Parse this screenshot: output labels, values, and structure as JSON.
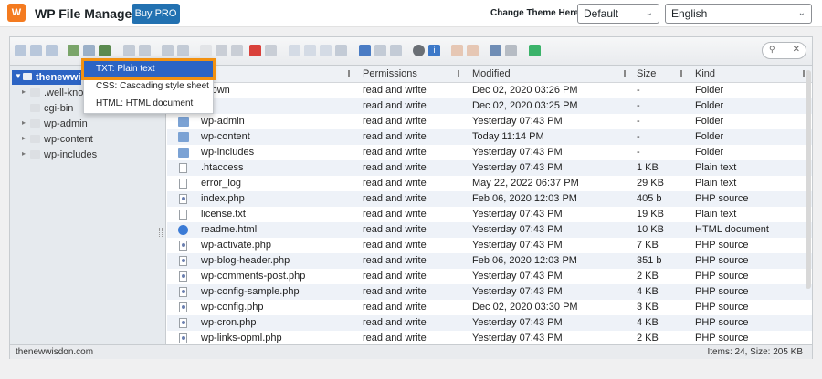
{
  "header": {
    "app_title": "WP File Manager",
    "buy_pro_label": "Buy PRO",
    "theme_label": "Change Theme Here:",
    "theme_value": "Default",
    "language_value": "English"
  },
  "tree": {
    "root_label": "thenewwisdon",
    "items": [
      {
        "label": ".well-known",
        "expandable": true
      },
      {
        "label": "cgi-bin",
        "expandable": false
      },
      {
        "label": "wp-admin",
        "expandable": true
      },
      {
        "label": "wp-content",
        "expandable": true
      },
      {
        "label": "wp-includes",
        "expandable": true
      }
    ]
  },
  "dropdown": {
    "items": [
      {
        "label": "TXT: Plain text",
        "selected": true
      },
      {
        "label": "CSS: Cascading style sheet",
        "selected": false
      },
      {
        "label": "HTML: HTML document",
        "selected": false
      }
    ]
  },
  "table": {
    "columns": [
      "Permissions",
      "Modified",
      "Size",
      "Kind"
    ],
    "rows": [
      {
        "name": "known",
        "perm": "read and write",
        "modified": "Dec 02, 2020 03:26 PM",
        "size": "-",
        "kind": "Folder",
        "icon": "folder"
      },
      {
        "name": "n",
        "perm": "read and write",
        "modified": "Dec 02, 2020 03:25 PM",
        "size": "-",
        "kind": "Folder",
        "icon": "folder"
      },
      {
        "name": "wp-admin",
        "perm": "read and write",
        "modified": "Yesterday 07:43 PM",
        "size": "-",
        "kind": "Folder",
        "icon": "folder"
      },
      {
        "name": "wp-content",
        "perm": "read and write",
        "modified": "Today 11:14 PM",
        "size": "-",
        "kind": "Folder",
        "icon": "folder"
      },
      {
        "name": "wp-includes",
        "perm": "read and write",
        "modified": "Yesterday 07:43 PM",
        "size": "-",
        "kind": "Folder",
        "icon": "folder"
      },
      {
        "name": ".htaccess",
        "perm": "read and write",
        "modified": "Yesterday 07:43 PM",
        "size": "1 KB",
        "kind": "Plain text",
        "icon": "file"
      },
      {
        "name": "error_log",
        "perm": "read and write",
        "modified": "May 22, 2022 06:37 PM",
        "size": "29 KB",
        "kind": "Plain text",
        "icon": "file"
      },
      {
        "name": "index.php",
        "perm": "read and write",
        "modified": "Feb 06, 2020 12:03 PM",
        "size": "405 b",
        "kind": "PHP source",
        "icon": "php"
      },
      {
        "name": "license.txt",
        "perm": "read and write",
        "modified": "Yesterday 07:43 PM",
        "size": "19 KB",
        "kind": "Plain text",
        "icon": "file"
      },
      {
        "name": "readme.html",
        "perm": "read and write",
        "modified": "Yesterday 07:43 PM",
        "size": "10 KB",
        "kind": "HTML document",
        "icon": "html"
      },
      {
        "name": "wp-activate.php",
        "perm": "read and write",
        "modified": "Yesterday 07:43 PM",
        "size": "7 KB",
        "kind": "PHP source",
        "icon": "php"
      },
      {
        "name": "wp-blog-header.php",
        "perm": "read and write",
        "modified": "Feb 06, 2020 12:03 PM",
        "size": "351 b",
        "kind": "PHP source",
        "icon": "php"
      },
      {
        "name": "wp-comments-post.php",
        "perm": "read and write",
        "modified": "Yesterday 07:43 PM",
        "size": "2 KB",
        "kind": "PHP source",
        "icon": "php"
      },
      {
        "name": "wp-config-sample.php",
        "perm": "read and write",
        "modified": "Yesterday 07:43 PM",
        "size": "4 KB",
        "kind": "PHP source",
        "icon": "php"
      },
      {
        "name": "wp-config.php",
        "perm": "read and write",
        "modified": "Dec 02, 2020 03:30 PM",
        "size": "3 KB",
        "kind": "PHP source",
        "icon": "php"
      },
      {
        "name": "wp-cron.php",
        "perm": "read and write",
        "modified": "Yesterday 07:43 PM",
        "size": "4 KB",
        "kind": "PHP source",
        "icon": "php"
      },
      {
        "name": "wp-links-opml.php",
        "perm": "read and write",
        "modified": "Yesterday 07:43 PM",
        "size": "2 KB",
        "kind": "PHP source",
        "icon": "php"
      }
    ]
  },
  "status": {
    "path": "thenewwisdon.com",
    "counts": "Items: 24, Size: 205 KB"
  },
  "colors": {
    "accent": "#2c64c4",
    "highlight": "#f29111",
    "brand": "#2271b1"
  }
}
